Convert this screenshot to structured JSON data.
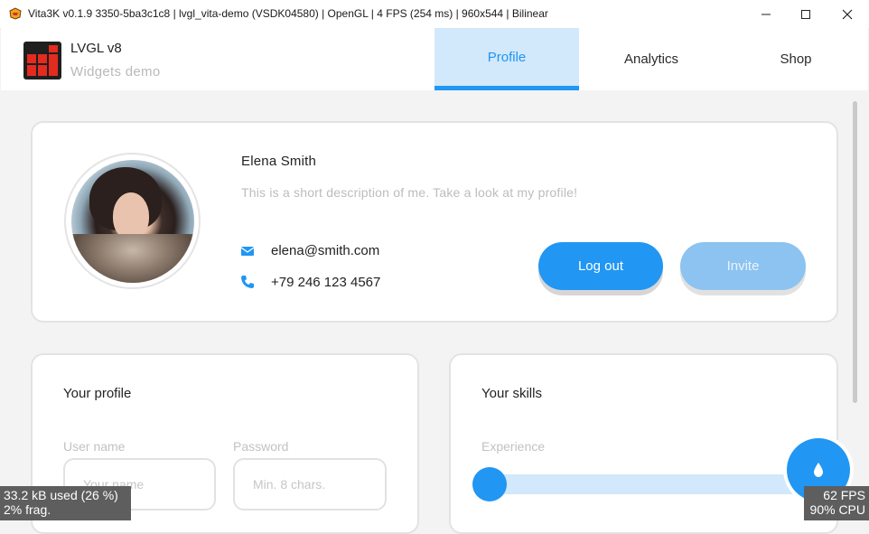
{
  "window": {
    "title": "Vita3K v0.1.9 3350-5ba3c1c8 | lvgl_vita-demo (VSDK04580) | OpenGL | 4 FPS (254 ms) | 960x544 | Bilinear",
    "icon": "vita3k-app-icon",
    "controls": [
      "minimize-icon",
      "maximize-icon",
      "close-icon"
    ]
  },
  "header": {
    "title": "LVGL v8",
    "subtitle": "Widgets demo",
    "tabs": [
      {
        "label": "Profile",
        "active": true
      },
      {
        "label": "Analytics",
        "active": false
      },
      {
        "label": "Shop",
        "active": false
      }
    ]
  },
  "profile": {
    "name": "Elena Smith",
    "description": "This is a short description of me. Take a look at my profile!",
    "email": "elena@smith.com",
    "phone": "+79 246 123 4567",
    "logout_label": "Log out",
    "invite_label": "Invite"
  },
  "your_profile": {
    "title": "Your profile",
    "username_label": "User name",
    "username_placeholder": "Your name",
    "password_label": "Password",
    "password_placeholder": "Min. 8 chars."
  },
  "skills": {
    "title": "Your skills",
    "experience_label": "Experience",
    "experience_value": 0
  },
  "overlays": {
    "memory_line1": "33.2 kB used (26 %)",
    "memory_line2": "2% frag.",
    "fps": "62 FPS",
    "cpu": "90% CPU"
  },
  "colors": {
    "accent": "#2196f3",
    "accent_light": "#d2e8fb",
    "invite": "#8cc3f0",
    "logo_red": "#e32b1f"
  }
}
